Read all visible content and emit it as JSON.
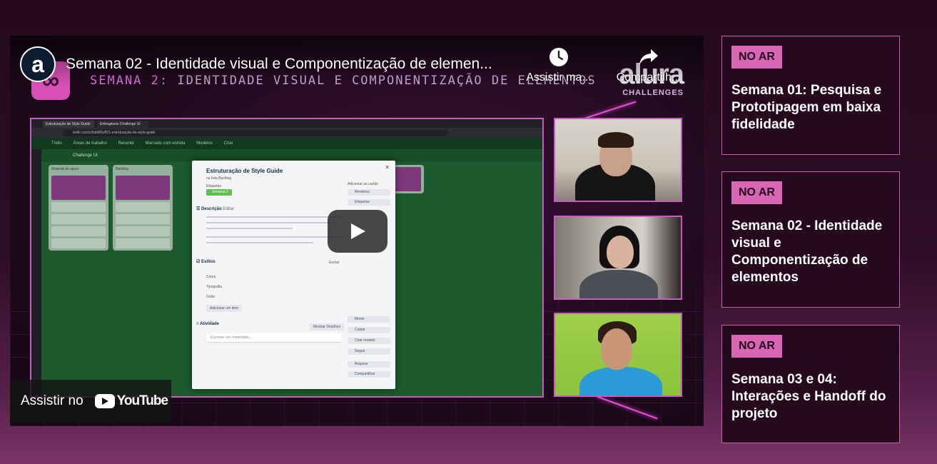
{
  "video": {
    "title": "Semana 02 - Identidade visual e Componentização de elemen...",
    "channel_initial": "a",
    "watch_later_label": "Assistir ma...",
    "share_label": "Compartilh...",
    "watch_on_label": "Assistir no",
    "youtube_label": "YouTube",
    "bg_heading_prefix": "SEMANA 2:",
    "bg_heading_rest": "IDENTIDADE VISUAL E COMPONENTIZAÇÃO DE ELEMENTOS",
    "brand_word": "alura",
    "brand_sub": "CHALLENGES"
  },
  "screen_share": {
    "tabs": [
      "Estruturação de Style Guide",
      "Entregáveis Challenge UI"
    ],
    "url": "trello.com/c/bxbBRzf5/1-estruturação-de-style-guide",
    "nav_items": [
      "Trello",
      "Áreas de trabalho",
      "Recente",
      "Marcado com estrela",
      "Modelos",
      "Criar"
    ],
    "board_name": "Challenge UI",
    "lists": [
      {
        "name": "Material de apoio"
      },
      {
        "name": "Backlog"
      }
    ],
    "modal": {
      "title": "Estruturação de Style Guide",
      "list_ref": "na lista Backlog",
      "labels_title": "Etiquetas",
      "label_chip": "Semana 2",
      "description_title": "Descrição",
      "edit_label": "Editar",
      "checklist_title": "Estilos",
      "delete_label": "Excluir",
      "checklist_items": [
        "Cores",
        "Tipografia",
        "Grids"
      ],
      "add_item": "Adicionar um item",
      "activity_title": "Atividade",
      "show_details": "Mostrar Detalhes",
      "comment_placeholder": "Escrever um comentário...",
      "sidebar_heading": "Adicionar ao cartão",
      "sidebar_buttons": [
        "Membros",
        "Etiquetas",
        "Mover",
        "Copiar",
        "Criar modelo",
        "Seguir",
        "Arquivar",
        "Compartilhar"
      ]
    }
  },
  "playlist": [
    {
      "badge": "NO AR",
      "title": "Semana 01: Pesquisa e Prototipagem em baixa fidelidade"
    },
    {
      "badge": "NO AR",
      "title": "Semana 02 - Identidade visual e Componentização de elementos"
    },
    {
      "badge": "NO AR",
      "title": "Semana 03 e 04: Interações e Handoff do projeto"
    }
  ],
  "colors": {
    "accent_pink": "#d965b5",
    "neon_border": "#c95cc0",
    "page_bg": "#2f0d27",
    "trello_green": "#1d5a2d"
  }
}
